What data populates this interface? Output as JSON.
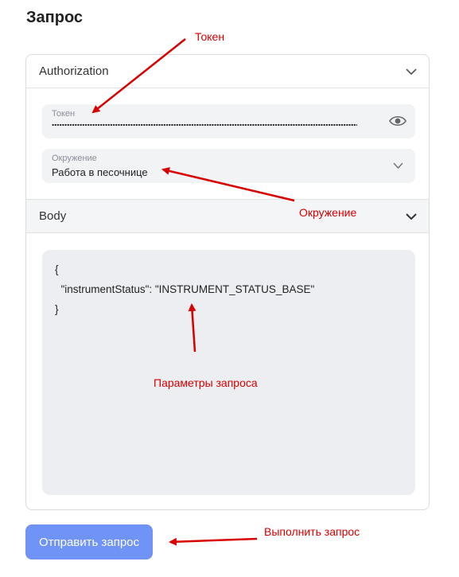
{
  "page": {
    "title": "Запрос"
  },
  "authorization": {
    "header_label": "Authorization",
    "token": {
      "label": "Токен",
      "masked_value": "••••••••••••••••••••••••••••••••••••••••••••••••••••••••••••••••••••••••••••••••••••••••••••••••••••••••••••••••••••••••••••"
    },
    "environment": {
      "label": "Окружение",
      "value": "Работа в песочнице"
    }
  },
  "body": {
    "header_label": "Body",
    "code_lines": [
      "{",
      "  \"instrumentStatus\": \"INSTRUMENT_STATUS_BASE\"",
      "}"
    ]
  },
  "actions": {
    "send_label": "Отправить запрос"
  },
  "annotations": {
    "token": "Токен",
    "environment": "Окружение",
    "params": "Параметры запроса",
    "execute": "Выполнить запрос"
  },
  "colors": {
    "accent_button": "#6f93f6",
    "annotation_red": "#d80000",
    "field_bg": "#f2f3f5"
  }
}
